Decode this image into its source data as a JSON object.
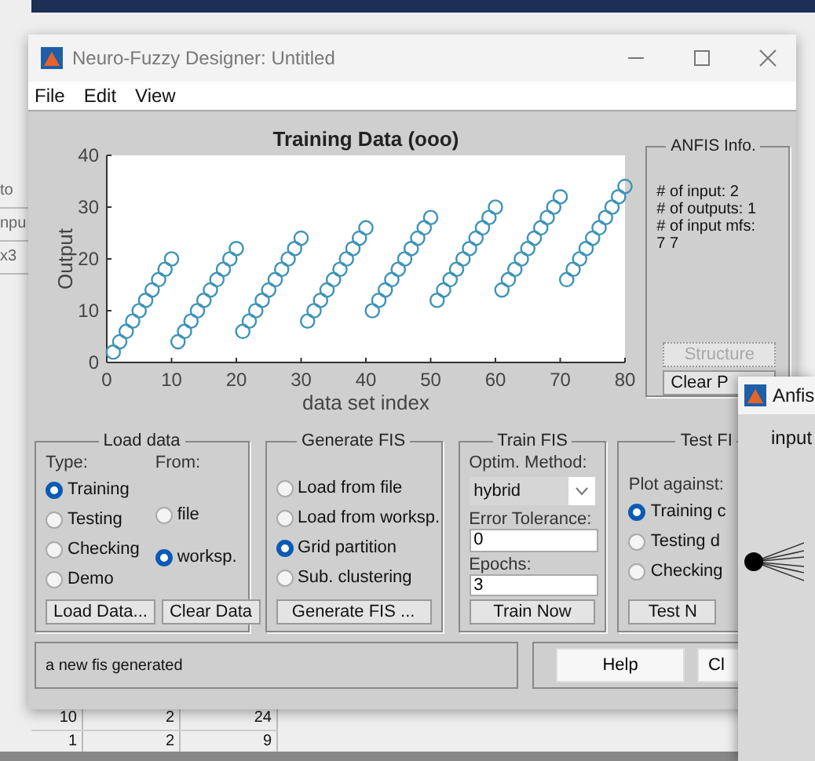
{
  "desktop": {
    "side_labels": [
      "to",
      "npu",
      "x3"
    ],
    "table_rows": [
      [
        "10",
        "2",
        "24"
      ],
      [
        "1",
        "2",
        "9"
      ]
    ]
  },
  "window": {
    "title": "Neuro-Fuzzy Designer: Untitled"
  },
  "menu": [
    "File",
    "Edit",
    "View"
  ],
  "plot": {
    "chart_data": {
      "type": "scatter",
      "title": "Training Data (ooo)",
      "xlabel": "data set index",
      "ylabel": "Output",
      "xlim": [
        0,
        80
      ],
      "ylim": [
        0,
        40
      ],
      "xticks": [
        0,
        10,
        20,
        30,
        40,
        50,
        60,
        70,
        80
      ],
      "yticks": [
        0,
        10,
        20,
        30,
        40
      ],
      "x": [
        1,
        2,
        3,
        4,
        5,
        6,
        7,
        8,
        9,
        10,
        11,
        12,
        13,
        14,
        15,
        16,
        17,
        18,
        19,
        20,
        21,
        22,
        23,
        24,
        25,
        26,
        27,
        28,
        29,
        30,
        31,
        32,
        33,
        34,
        35,
        36,
        37,
        38,
        39,
        40,
        41,
        42,
        43,
        44,
        45,
        46,
        47,
        48,
        49,
        50,
        51,
        52,
        53,
        54,
        55,
        56,
        57,
        58,
        59,
        60,
        61,
        62,
        63,
        64,
        65,
        66,
        67,
        68,
        69,
        70,
        71,
        72,
        73,
        74,
        75,
        76,
        77,
        78,
        79,
        80
      ],
      "series": [
        {
          "color": "#3d93b8",
          "values": [
            2,
            4,
            6,
            8,
            10,
            12,
            14,
            16,
            18,
            20,
            4,
            6,
            8,
            10,
            12,
            14,
            16,
            18,
            20,
            22,
            6,
            8,
            10,
            12,
            14,
            16,
            18,
            20,
            22,
            24,
            8,
            10,
            12,
            14,
            16,
            18,
            20,
            22,
            24,
            26,
            10,
            12,
            14,
            16,
            18,
            20,
            22,
            24,
            26,
            28,
            12,
            14,
            16,
            18,
            20,
            22,
            24,
            26,
            28,
            30,
            14,
            16,
            18,
            20,
            22,
            24,
            26,
            28,
            30,
            32,
            16,
            18,
            20,
            22,
            24,
            26,
            28,
            30,
            32,
            34
          ]
        }
      ]
    }
  },
  "anfis_info": {
    "title": "ANFIS Info.",
    "lines": [
      "# of input: 2",
      "# of outputs: 1",
      "# of input mfs:",
      "7  7"
    ],
    "buttons": [
      {
        "label": "Structure",
        "disabled": true
      },
      {
        "label": "Clear P",
        "disabled": false
      }
    ]
  },
  "load_data": {
    "title": "Load data",
    "type_label": "Type:",
    "from_label": "From:",
    "type_options": [
      {
        "label": "Training",
        "selected": true
      },
      {
        "label": "Testing",
        "selected": false
      },
      {
        "label": "Checking",
        "selected": false
      },
      {
        "label": "Demo",
        "selected": false
      }
    ],
    "from_options": [
      {
        "label": "file",
        "selected": false
      },
      {
        "label": "worksp.",
        "selected": true
      }
    ],
    "buttons": [
      "Load Data...",
      "Clear Data"
    ]
  },
  "generate_fis": {
    "title": "Generate FIS",
    "options": [
      {
        "label": "Load from file",
        "selected": false
      },
      {
        "label": "Load from worksp.",
        "selected": false
      },
      {
        "label": "Grid partition",
        "selected": true
      },
      {
        "label": "Sub. clustering",
        "selected": false
      }
    ],
    "button": "Generate FIS ..."
  },
  "train_fis": {
    "title": "Train FIS",
    "method_label": "Optim. Method:",
    "method": "hybrid",
    "tolerance_label": "Error Tolerance:",
    "tolerance": "0",
    "epochs_label": "Epochs:",
    "epochs": "3",
    "button": "Train Now"
  },
  "test_fis": {
    "title": "Test FI",
    "plot_label": "Plot against:",
    "options": [
      {
        "label": "Training c",
        "selected": true
      },
      {
        "label": "Testing d",
        "selected": false
      },
      {
        "label": "Checking",
        "selected": false
      }
    ],
    "button": "Test N"
  },
  "status": "a new fis generated",
  "buttons": [
    "Help",
    "Cl"
  ],
  "anfis_window": {
    "title": "Anfis",
    "label": "input"
  }
}
